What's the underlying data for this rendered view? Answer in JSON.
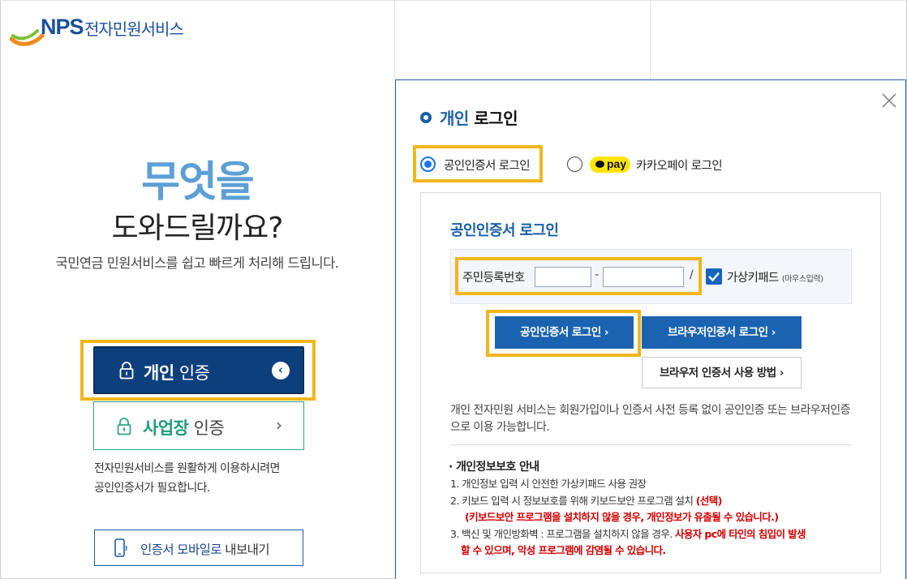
{
  "header": {
    "brand": "NPS",
    "service": "전자민원서비스"
  },
  "hero": {
    "line1": "무엇을",
    "line2": "도와드릴까요?",
    "line3": "국민연금 민원서비스를 쉽고 빠르게 처리해 드립니다."
  },
  "auth": {
    "personal_bold": "개인",
    "personal_rest": " 인증",
    "business_bold": "사업장",
    "business_rest": " 인증",
    "note_line1": "전자민원서비스를 원활하게 이용하시려면",
    "note_line2": "공인인증서가 필요합니다.",
    "mobile_bold": "인증서 모바일로",
    "mobile_rest": " 내보내기"
  },
  "modal": {
    "title_blue": "개인",
    "title_rest": " 로그인",
    "options": [
      {
        "label": "공인인증서 로그인",
        "selected": true
      },
      {
        "label": "카카오페이 로그인",
        "selected": false
      }
    ],
    "kakaopay_badge": "pay",
    "panel_title": "공인인증서 로그인",
    "ssn_label": "주민등록번호",
    "ssn_front": "",
    "ssn_back": "",
    "ssn_dash": "-",
    "ssn_slash": "/",
    "virtual_keypad_label": "가상키패드",
    "virtual_keypad_note": "(마우스입력)",
    "virtual_keypad_checked": true,
    "btn_cert": "공인인증서 로그인 ›",
    "btn_browser": "브라우저인증서 로그인 ›",
    "btn_browser_help": "브라우저 인증서 사용 방법 ›",
    "description": "개인 전자민원 서비스는 회원가입이나 인증서 사전 등록 없이 공인인증 또는 브라우저인증으로 이용 가능합니다.",
    "privacy_title": "· 개인정보보호 안내",
    "privacy": {
      "item1": "1. 개인정보 입력 시 안전한 가상키패드 사용 권장",
      "item2": "2. 키보드 입력 시 정보보호를 위해 키보드보안 프로그램 설치",
      "item2_red": "(선택)",
      "item2_warn": "(키보드보안 프로그램을 설치하지 않을 경우, 개인정보가 유출될 수 있습니다.)",
      "item3": "3. 백신 및 개인방화벽 : 프로그램을 설치하지 않을 경우.",
      "item3_red": "사용자 pc에 타인의 침입이 발생",
      "item3_red2": "할 수 있으며, 악성 프로그램에 감염될 수 있습니다."
    }
  },
  "colors": {
    "primary": "#0e3f7d",
    "accent_blue": "#1b63b0",
    "highlight": "#f2b61c",
    "business_green": "#2fa384",
    "kakao_yellow": "#fee500",
    "warning_red": "#d40000"
  }
}
